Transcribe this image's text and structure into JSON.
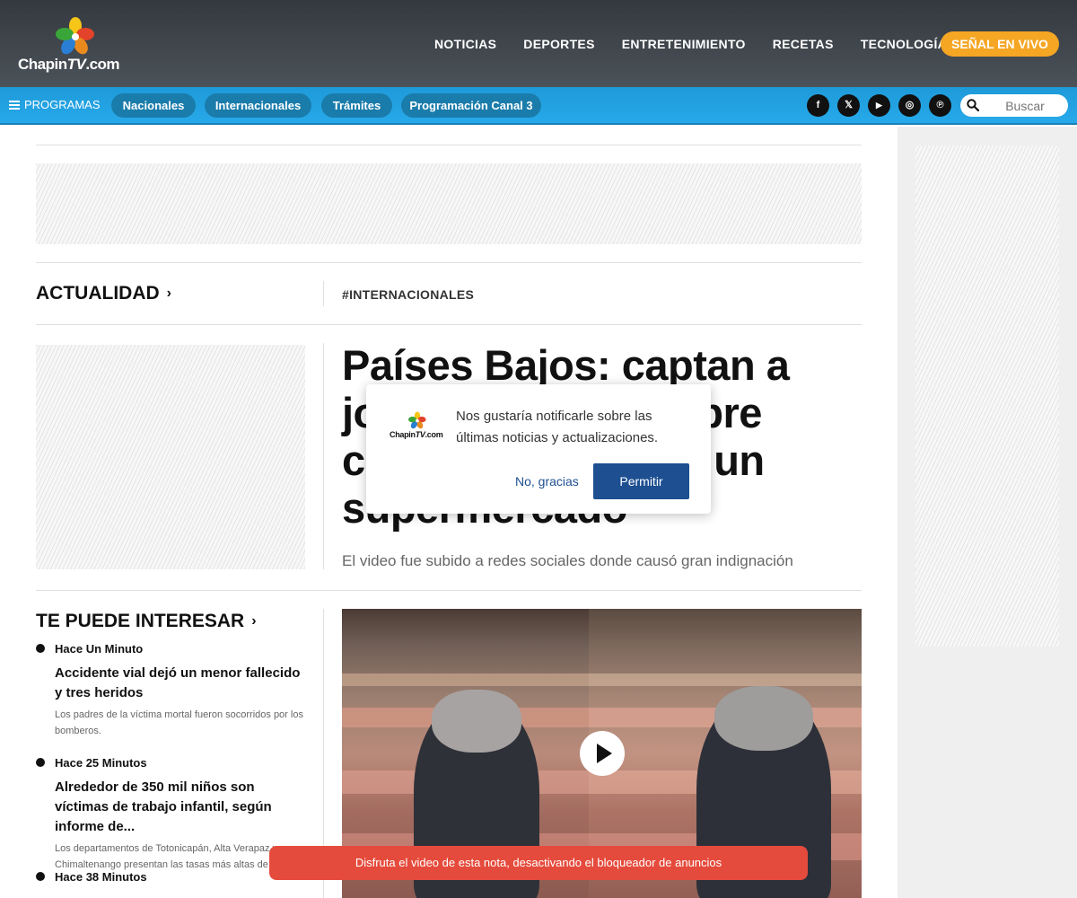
{
  "header": {
    "logo_text_a": "Chapin",
    "logo_text_b": "TV",
    "logo_text_c": ".com",
    "nav": [
      "NOTICIAS",
      "DEPORTES",
      "ENTRETENIMIENTO",
      "RECETAS",
      "TECNOLOGÍA"
    ],
    "live_label": "SEÑAL EN VIVO",
    "live_color": "#f5a623"
  },
  "subnav": {
    "programs_label": "PROGRAMAS",
    "pills": [
      "Nacionales",
      "Internacionales",
      "Trámites",
      "Programación Canal 3"
    ],
    "social_icons": [
      "facebook-icon",
      "x-icon",
      "youtube-icon",
      "instagram-icon",
      "pinterest-icon"
    ],
    "social_glyphs": [
      "f",
      "𝕏",
      "▶",
      "◎",
      "℗"
    ],
    "search_placeholder": "Buscar"
  },
  "article": {
    "section": "ACTUALIDAD",
    "tag": "#INTERNACIONALES",
    "headline": "Países Bajos: captan a joven orinando sobre carne expuesta en un supermercado",
    "subtitle": "El video fue subido a redes sociales donde causó gran indignación"
  },
  "interest": {
    "title": "TE PUEDE INTERESAR",
    "items": [
      {
        "time": "Hace Un Minuto",
        "title": "Accidente vial dejó un menor fallecido y tres heridos",
        "desc": "Los padres de la víctima mortal fueron socorridos por los bomberos."
      },
      {
        "time": "Hace 25 Minutos",
        "title": "Alrededor de 350 mil niños son víctimas de trabajo infantil, según informe de...",
        "desc": "Los departamentos de Totonicapán, Alta Verapaz y Chimaltenango presentan las tasas más altas de traba..."
      },
      {
        "time": "Hace 38 Minutos",
        "title": "",
        "desc": ""
      }
    ]
  },
  "toast": {
    "message": "Disfruta el video de esta nota, desactivando el bloqueador de anuncios",
    "color": "#e54b3c"
  },
  "popup": {
    "logo_text_a": "Chapin",
    "logo_text_b": "TV",
    "logo_text_c": ".com",
    "message": "Nos gustaría notificarle sobre las últimas noticias y actualizaciones.",
    "decline_label": "No, gracias",
    "allow_label": "Permitir",
    "accent": "#1d4f91"
  }
}
